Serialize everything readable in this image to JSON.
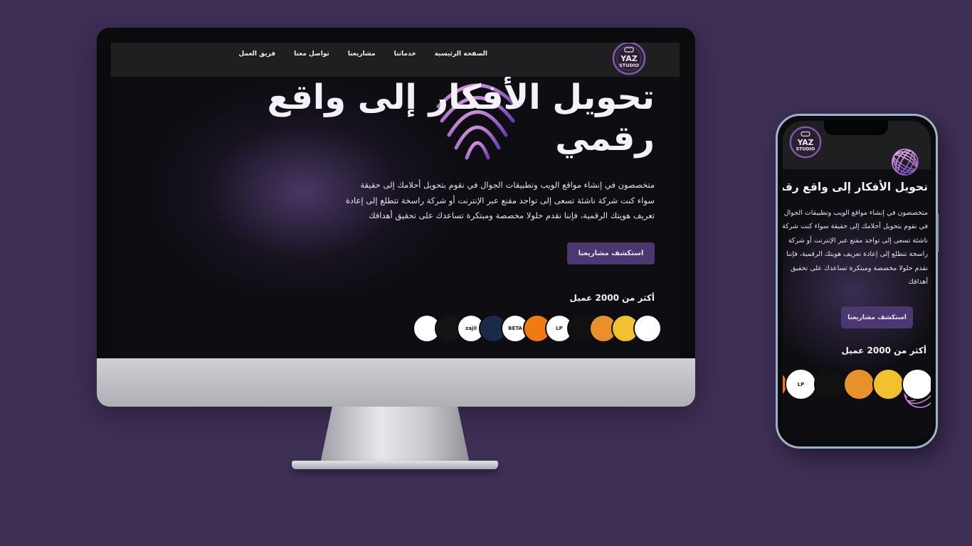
{
  "colors": {
    "background": "#3e2f55",
    "accent": "#4b3872",
    "nav_bg": "#1f1f22",
    "screen_bg": "#0e0d11"
  },
  "logo": {
    "line1": "YAZ",
    "line2": "STUDIO"
  },
  "nav": {
    "items": [
      {
        "label": "الصفحة الرئيسية"
      },
      {
        "label": "خدماتنا"
      },
      {
        "label": "مشاريعنا"
      },
      {
        "label": "تواصل معنا"
      },
      {
        "label": "فريق العمل"
      }
    ]
  },
  "hero": {
    "title_line1": "تحويل الأفكار إلى واقع",
    "title_line2": "رقمي",
    "text": "متخصصون في إنشاء مواقع الويب وتطبيقات الجوال في نقوم بتحويل أحلامك إلى حقيقة سواء كنت شركة ناشئة تسعى إلى تواجد مقنع عبر الإنترنت أو شركة راسخة تتطلع إلى إعادة تعريف هويتك الرقمية، فإننا نقدم حلولا مخصصة ومبتكرة تساعدك على تحقيق أهدافك",
    "cta_label": "استكشف مشاريعنا"
  },
  "clients": {
    "label": "أكثر من 2000 عميل",
    "logos": [
      {
        "icon": "client-logo-teal-text",
        "text": "",
        "bg": "#ffffff"
      },
      {
        "icon": "client-logo-woman-portrait-yellow",
        "text": "",
        "bg": "#f2c12e"
      },
      {
        "icon": "client-logo-portrait-orange",
        "text": "",
        "bg": "#e8902a"
      },
      {
        "icon": "client-logo-red-trident",
        "text": "",
        "bg": "#111111"
      },
      {
        "icon": "client-logo-learn-plus",
        "text": "LP",
        "bg": "#ffffff"
      },
      {
        "icon": "client-logo-orange-arabic",
        "text": "",
        "bg": "#f07b12"
      },
      {
        "icon": "client-logo-beta",
        "text": "BETA",
        "bg": "#ffffff"
      },
      {
        "icon": "client-logo-navy-emblem",
        "text": "",
        "bg": "#1c2a4a"
      },
      {
        "icon": "client-logo-zajil",
        "text": "zajil",
        "bg": "#ffffff"
      },
      {
        "icon": "client-logo-dark-emblem",
        "text": "",
        "bg": "#141414"
      },
      {
        "icon": "client-logo-grey-wordmark",
        "text": "",
        "bg": "#ffffff"
      }
    ]
  },
  "phone": {
    "title": "تحويل الأفكار إلى واقع رقمي",
    "text_lines": [
      "متخصصون في إنشاء مواقع الويب وتطبيقات الجوال",
      "في نقوم بتحويل أحلامك إلى حقيقة سواء كنت شركة",
      "ناشئة تسعى إلى تواجد مقنع عبر الإنترنت أو شركة",
      "راسخة تتطلع إلى إعادة تعريف هويتك الرقمية، فإننا",
      "نقدم حلولا مخصصة ومبتكرة تساعدك على تحقيق",
      "أهدافك"
    ],
    "cta_label": "استكشف مشاريعنا",
    "clients_label": "أكثر من 2000 عميل"
  }
}
